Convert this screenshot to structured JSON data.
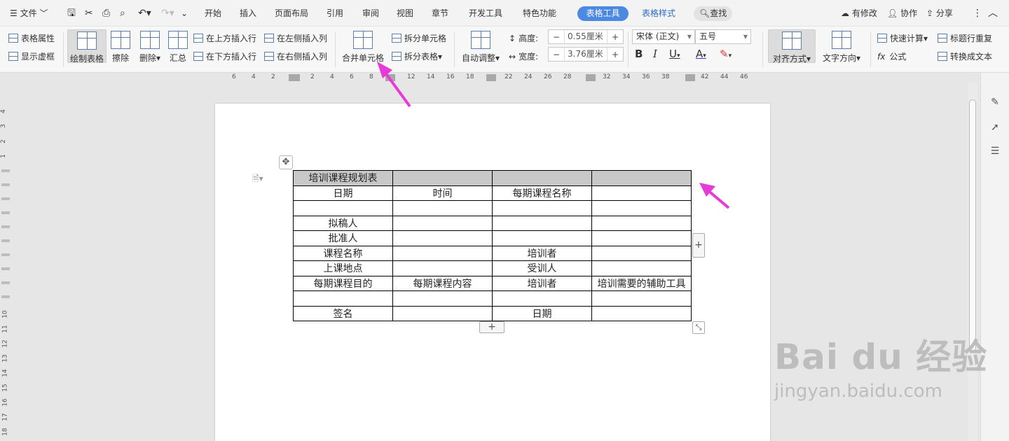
{
  "menubar": {
    "file_label": "文件",
    "tabs": [
      "开始",
      "插入",
      "页面布局",
      "引用",
      "审阅",
      "视图",
      "章节",
      "开发工具",
      "特色功能"
    ],
    "active_tab": "表格工具",
    "style_tab": "表格样式",
    "search_label": "查找",
    "right": {
      "modified": "有修改",
      "collab": "协作",
      "share": "分享"
    }
  },
  "ribbon": {
    "table_props": "表格属性",
    "show_grid": "显示虚框",
    "draw_table": "绘制表格",
    "erase": "擦除",
    "delete": "删除",
    "summary": "汇总",
    "insert_above": "在上方插入行",
    "insert_below": "在下方插入行",
    "insert_left": "在左侧插入列",
    "insert_right": "在右侧插入列",
    "merge_cells": "合并单元格",
    "split_cells": "拆分单元格",
    "split_table": "拆分表格",
    "auto_adjust": "自动调整",
    "height_label": "高度:",
    "height_value": "0.55厘米",
    "width_label": "宽度:",
    "width_value": "3.76厘米",
    "font_name": "宋体 (正文)",
    "font_size": "五号",
    "align": "对齐方式",
    "text_dir": "文字方向",
    "quick_calc": "快速计算",
    "repeat_header": "标题行重复",
    "formula": "公式",
    "to_text": "转换成文本"
  },
  "ruler": {
    "h_numbers": [
      "6",
      "4",
      "2",
      "2",
      "4",
      "6",
      "8",
      "12",
      "14",
      "16",
      "18",
      "22",
      "24",
      "26",
      "28",
      "32",
      "34",
      "36",
      "38",
      "42",
      "44",
      "46"
    ],
    "v_numbers": [
      "4",
      "3",
      "2",
      "1",
      "10",
      "11",
      "12",
      "13",
      "14",
      "15",
      "16",
      "17",
      "18"
    ]
  },
  "table": {
    "rows": [
      [
        "培训课程规划表",
        "",
        "",
        ""
      ],
      [
        "日期",
        "时间",
        "每期课程名称",
        ""
      ],
      [
        "",
        "",
        "",
        ""
      ],
      [
        "拟稿人",
        "",
        "",
        ""
      ],
      [
        "批准人",
        "",
        "",
        ""
      ],
      [
        "课程名称",
        "",
        "培训者",
        ""
      ],
      [
        "上课地点",
        "",
        "受训人",
        ""
      ],
      [
        "每期课程目的",
        "每期课程内容",
        "培训者",
        "培训需要的辅助工具"
      ],
      [
        "",
        "",
        "",
        ""
      ],
      [
        "签名",
        "",
        "日期",
        ""
      ]
    ]
  },
  "watermark": {
    "line1": "Bai du 经验",
    "line2": "jingyan.baidu.com"
  },
  "colors": {
    "accent": "#4c89e3",
    "arrow": "#e83ad6",
    "header_row": "#c8c8c8"
  }
}
